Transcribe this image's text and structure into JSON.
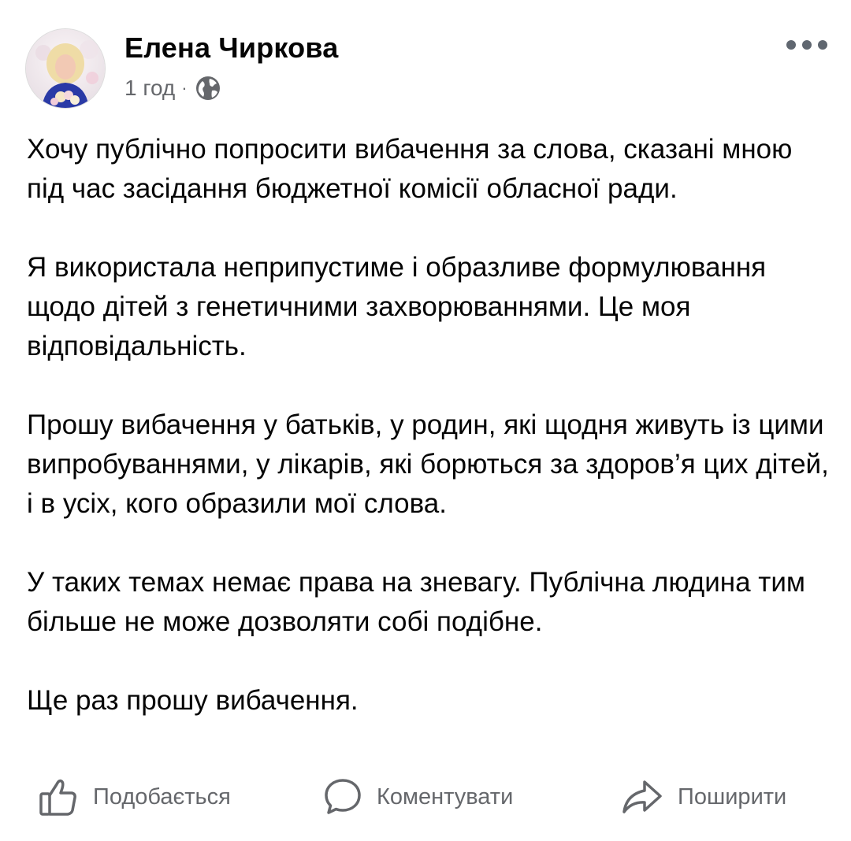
{
  "post": {
    "author": "Елена Чиркова",
    "time": "1 год",
    "separator": "·",
    "audience_icon": "globe-icon",
    "more_icon": "more-options-icon",
    "paragraphs": [
      "Хочу публічно попросити вибачення за слова, сказані мною під час засідання бюджетної комісії обласної ради.",
      "Я використала неприпустиме і образливе формулювання щодо дітей з генетичними захворюваннями. Це моя відповідальність.",
      "Прошу вибачення у батьків, у родин, які щодня живуть із цими випробуваннями, у лікарів, які борються за здоров’я цих дітей, і в усіх, кого образили мої слова.",
      "У таких темах немає права на зневагу. Публічна людина тим більше не може дозволяти собі подібне.",
      "Ще раз прошу вибачення."
    ]
  },
  "actions": {
    "like_label": "Подобається",
    "comment_label": "Коментувати",
    "share_label": "Поширити"
  },
  "colors": {
    "text": "#050505",
    "secondary": "#65676b",
    "background": "#ffffff"
  }
}
